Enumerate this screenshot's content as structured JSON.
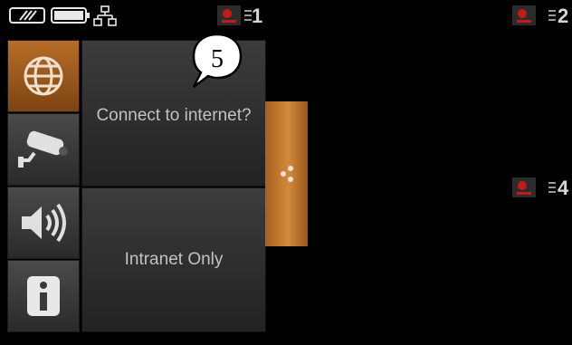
{
  "status_bar": {
    "icons": [
      "network-status-icon",
      "battery-icon",
      "connection-tree-icon"
    ]
  },
  "cameras": [
    {
      "id": "cam1",
      "number": "1"
    },
    {
      "id": "cam2",
      "number": "2"
    },
    {
      "id": "cam4",
      "number": "4"
    }
  ],
  "sidebar": {
    "items": [
      {
        "icon": "globe-icon",
        "active": true
      },
      {
        "icon": "camera-icon",
        "active": false
      },
      {
        "icon": "speaker-icon",
        "active": false
      },
      {
        "icon": "info-icon",
        "active": false
      }
    ]
  },
  "panels": {
    "connect_internet": "Connect to internet?",
    "intranet_only": "Intranet Only"
  },
  "callout": {
    "number": "5"
  },
  "colors": {
    "accent": "#b86d28",
    "background": "#000000"
  }
}
